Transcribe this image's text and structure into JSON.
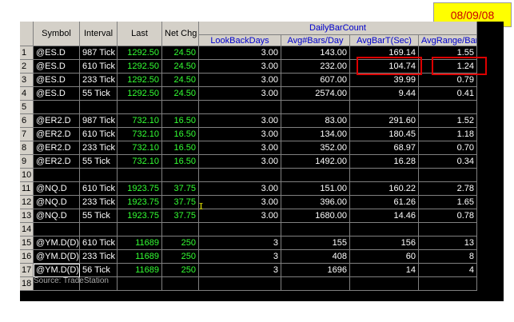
{
  "date_badge": "08/09/08",
  "group_header": "DailyBarCount",
  "columns": [
    "Symbol",
    "Interval",
    "Last",
    "Net Chg",
    "LookBackDays",
    "Avg#Bars/Day",
    "AvgBarT(Sec)",
    "AvgRange/Bar"
  ],
  "rows": [
    {
      "n": "1",
      "cells": [
        "@ES.D",
        "987 Tick",
        "1292.50",
        "24.50",
        "3.00",
        "143.00",
        "169.14",
        "1.55"
      ]
    },
    {
      "n": "2",
      "cells": [
        "@ES.D",
        "610 Tick",
        "1292.50",
        "24.50",
        "3.00",
        "232.00",
        "104.74",
        "1.24"
      ]
    },
    {
      "n": "3",
      "cells": [
        "@ES.D",
        "233 Tick",
        "1292.50",
        "24.50",
        "3.00",
        "607.00",
        "39.99",
        "0.79"
      ]
    },
    {
      "n": "4",
      "cells": [
        "@ES.D",
        "55 Tick",
        "1292.50",
        "24.50",
        "3.00",
        "2574.00",
        "9.44",
        "0.41"
      ]
    },
    {
      "n": "5",
      "cells": [
        "",
        "",
        "",
        "",
        "",
        "",
        "",
        ""
      ]
    },
    {
      "n": "6",
      "cells": [
        "@ER2.D",
        "987 Tick",
        "732.10",
        "16.50",
        "3.00",
        "83.00",
        "291.60",
        "1.52"
      ]
    },
    {
      "n": "7",
      "cells": [
        "@ER2.D",
        "610 Tick",
        "732.10",
        "16.50",
        "3.00",
        "134.00",
        "180.45",
        "1.18"
      ]
    },
    {
      "n": "8",
      "cells": [
        "@ER2.D",
        "233 Tick",
        "732.10",
        "16.50",
        "3.00",
        "352.00",
        "68.97",
        "0.70"
      ]
    },
    {
      "n": "9",
      "cells": [
        "@ER2.D",
        "55 Tick",
        "732.10",
        "16.50",
        "3.00",
        "1492.00",
        "16.28",
        "0.34"
      ]
    },
    {
      "n": "10",
      "cells": [
        "",
        "",
        "",
        "",
        "",
        "",
        "",
        ""
      ]
    },
    {
      "n": "11",
      "cells": [
        "@NQ.D",
        "610 Tick",
        "1923.75",
        "37.75",
        "3.00",
        "151.00",
        "160.22",
        "2.78"
      ]
    },
    {
      "n": "12",
      "cells": [
        "@NQ.D",
        "233 Tick",
        "1923.75",
        "37.75",
        "3.00",
        "396.00",
        "61.26",
        "1.65"
      ]
    },
    {
      "n": "13",
      "cells": [
        "@NQ.D",
        "55 Tick",
        "1923.75",
        "37.75",
        "3.00",
        "1680.00",
        "14.46",
        "0.78"
      ]
    },
    {
      "n": "14",
      "cells": [
        "",
        "",
        "",
        "",
        "",
        "",
        "",
        ""
      ]
    },
    {
      "n": "15",
      "cells": [
        "@YM.D(D)",
        "610 Tick",
        "11689",
        "250",
        "3",
        "155",
        "156",
        "13"
      ]
    },
    {
      "n": "16",
      "cells": [
        "@YM.D(D)",
        "233 Tick",
        "11689",
        "250",
        "3",
        "408",
        "60",
        "8"
      ]
    },
    {
      "n": "17",
      "cells": [
        "@YM.D(D)",
        "56 Tick",
        "11689",
        "250",
        "3",
        "1696",
        "14",
        "4"
      ]
    },
    {
      "n": "18",
      "cells": [
        "",
        "",
        "",
        "",
        "",
        "",
        "",
        ""
      ]
    }
  ],
  "source_note": "Source: TradeStation",
  "colors": {
    "badge_bg": "#ffff00",
    "badge_text": "#cc0000",
    "grid_bg": "#000000",
    "header_bg": "#d4d0c8",
    "green": "#33ff33",
    "white": "#ffffff",
    "highlight": "#dd0000"
  }
}
